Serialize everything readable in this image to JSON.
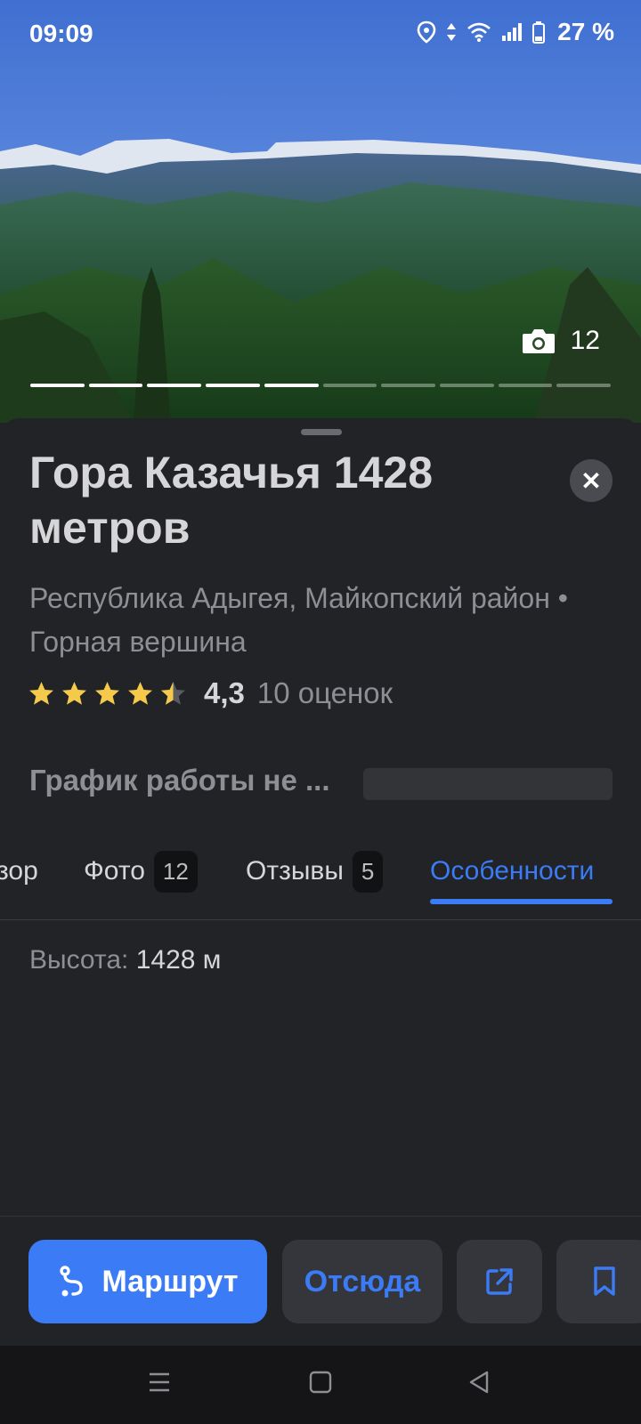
{
  "status_bar": {
    "time": "09:09",
    "battery": "27 %"
  },
  "photo": {
    "count": "12",
    "total_photos": 10,
    "active_segments": 5
  },
  "place": {
    "title": "Гора Казачья 1428 метров",
    "subtitle": "Республика Адыгея, Майкопский район • Горная вершина",
    "rating_value": "4,3",
    "rating_stars": 4.5,
    "rating_count": "10 оценок",
    "hours": "График работы не ..."
  },
  "tabs": [
    {
      "label": "зор"
    },
    {
      "label": "Фото",
      "badge": "12"
    },
    {
      "label": "Отзывы",
      "badge": "5"
    },
    {
      "label": "Особенности"
    }
  ],
  "features": {
    "height_label": "Высота:",
    "height_value": "1428 м"
  },
  "actions": {
    "route": "Маршрут",
    "from_here": "Отсюда"
  },
  "colors": {
    "accent": "#3b7cf6",
    "background": "#222326",
    "star": "#f5c94a"
  }
}
